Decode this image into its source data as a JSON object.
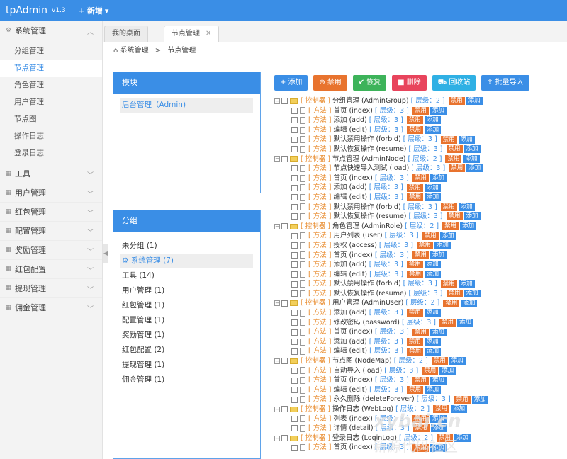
{
  "app": {
    "title": "tpAdmin",
    "version": "v1.3",
    "add_new": "新增"
  },
  "sidebar": [
    {
      "label": "系统管理",
      "icon": "gear-icon",
      "expanded": true,
      "items": [
        "分组管理",
        "节点管理",
        "角色管理",
        "用户管理",
        "节点图",
        "操作日志",
        "登录日志"
      ],
      "active": "节点管理"
    },
    {
      "label": "工具",
      "icon": "grid-icon"
    },
    {
      "label": "用户管理",
      "icon": "grid-icon"
    },
    {
      "label": "红包管理",
      "icon": "grid-icon"
    },
    {
      "label": "配置管理",
      "icon": "grid-icon"
    },
    {
      "label": "奖励管理",
      "icon": "grid-icon"
    },
    {
      "label": "红包配置",
      "icon": "grid-icon"
    },
    {
      "label": "提现管理",
      "icon": "grid-icon"
    },
    {
      "label": "佣金管理",
      "icon": "grid-icon"
    }
  ],
  "tabs": [
    {
      "label": "我的桌面",
      "active": false
    },
    {
      "label": "节点管理",
      "active": true
    }
  ],
  "breadcrumb": {
    "home": "系统管理",
    "sep": ">",
    "current": "节点管理"
  },
  "module_panel": {
    "title": "模块",
    "items": [
      "后台管理（Admin)"
    ]
  },
  "group_panel": {
    "title": "分组",
    "items": [
      "未分组 (1)",
      "系统管理 (7)",
      "工具 (14)",
      "用户管理 (1)",
      "红包管理 (1)",
      "配置管理 (1)",
      "奖励管理 (1)",
      "红包配置 (2)",
      "提现管理 (1)",
      "佣金管理 (1)"
    ],
    "selected": "系统管理 (7)"
  },
  "toolbar": [
    {
      "label": "添加",
      "icon": "plus-icon",
      "color": "#3a8ee6"
    },
    {
      "label": "禁用",
      "icon": "minus-circle-icon",
      "color": "#e8732e"
    },
    {
      "label": "恢复",
      "icon": "check-circle-icon",
      "color": "#3db35a"
    },
    {
      "label": "删除",
      "icon": "trash-icon",
      "color": "#e8445c"
    },
    {
      "label": "回收站",
      "icon": "cart-icon",
      "color": "#2fb0e4"
    },
    {
      "label": "批量导入",
      "icon": "import-icon",
      "color": "#3a8ee6"
    }
  ],
  "tree_labels": {
    "controller": "[ 控制器 ]",
    "method": "[ 方法 ]",
    "disable": "禁用",
    "add": "添加"
  },
  "tree": [
    {
      "kind": "c",
      "name": "分组管理 (AdminGroup)",
      "level": "[ 层级：2 ]"
    },
    {
      "kind": "m",
      "name": "首页 (index)",
      "level": "[ 层级：3 ]"
    },
    {
      "kind": "m",
      "name": "添加 (add)",
      "level": "[ 层级：3 ]"
    },
    {
      "kind": "m",
      "name": "编辑 (edit)",
      "level": "[ 层级：3 ]"
    },
    {
      "kind": "m",
      "name": "默认禁用操作 (forbid)",
      "level": "[ 层级：3 ]"
    },
    {
      "kind": "m",
      "name": "默认恢复操作 (resume)",
      "level": "[ 层级：3 ]"
    },
    {
      "kind": "c",
      "name": "节点管理 (AdminNode)",
      "level": "[ 层级：2 ]"
    },
    {
      "kind": "m",
      "name": "节点快速导入测试 (load)",
      "level": "[ 层级：3 ]"
    },
    {
      "kind": "m",
      "name": "首页 (index)",
      "level": "[ 层级：3 ]"
    },
    {
      "kind": "m",
      "name": "添加 (add)",
      "level": "[ 层级：3 ]"
    },
    {
      "kind": "m",
      "name": "编辑 (edit)",
      "level": "[ 层级：3 ]"
    },
    {
      "kind": "m",
      "name": "默认禁用操作 (forbid)",
      "level": "[ 层级：3 ]"
    },
    {
      "kind": "m",
      "name": "默认恢复操作 (resume)",
      "level": "[ 层级：3 ]"
    },
    {
      "kind": "c",
      "name": "角色管理 (AdminRole)",
      "level": "[ 层级：2 ]"
    },
    {
      "kind": "m",
      "name": "用户列表 (user)",
      "level": "[ 层级：3 ]"
    },
    {
      "kind": "m",
      "name": "授权 (access)",
      "level": "[ 层级：3 ]"
    },
    {
      "kind": "m",
      "name": "首页 (index)",
      "level": "[ 层级：3 ]"
    },
    {
      "kind": "m",
      "name": "添加 (add)",
      "level": "[ 层级：3 ]"
    },
    {
      "kind": "m",
      "name": "编辑 (edit)",
      "level": "[ 层级：3 ]"
    },
    {
      "kind": "m",
      "name": "默认禁用操作 (forbid)",
      "level": "[ 层级：3 ]"
    },
    {
      "kind": "m",
      "name": "默认恢复操作 (resume)",
      "level": "[ 层级：3 ]"
    },
    {
      "kind": "c",
      "name": "用户管理 (AdminUser)",
      "level": "[ 层级：2 ]"
    },
    {
      "kind": "m",
      "name": "添加 (add)",
      "level": "[ 层级：3 ]"
    },
    {
      "kind": "m",
      "name": "修改密码 (password)",
      "level": "[ 层级：3 ]"
    },
    {
      "kind": "m",
      "name": "首页 (index)",
      "level": "[ 层级：3 ]"
    },
    {
      "kind": "m",
      "name": "添加 (add)",
      "level": "[ 层级：3 ]"
    },
    {
      "kind": "m",
      "name": "编辑 (edit)",
      "level": "[ 层级：3 ]"
    },
    {
      "kind": "c",
      "name": "节点图 (NodeMap)",
      "level": "[ 层级：2 ]"
    },
    {
      "kind": "m",
      "name": "自动导入 (load)",
      "level": "[ 层级：3 ]"
    },
    {
      "kind": "m",
      "name": "首页 (index)",
      "level": "[ 层级：3 ]"
    },
    {
      "kind": "m",
      "name": "编辑 (edit)",
      "level": "[ 层级：3 ]"
    },
    {
      "kind": "m",
      "name": "永久删除 (deleteForever)",
      "level": "[ 层级：3 ]"
    },
    {
      "kind": "c",
      "name": "操作日志 (WebLog)",
      "level": "[ 层级：2 ]"
    },
    {
      "kind": "m",
      "name": "列表 (index)",
      "level": "[ 层级：3 ]"
    },
    {
      "kind": "m",
      "name": "详情 (detail)",
      "level": "[ 层级：3 ]"
    },
    {
      "kind": "c",
      "name": "登录日志 (LoginLog)",
      "level": "[ 层级：2 ]"
    },
    {
      "kind": "m",
      "name": "首页 (index)",
      "level": "[ 层级：3 ]"
    }
  ],
  "watermark": {
    "line1": "xybai.cn",
    "line2": "新源代码社区"
  }
}
